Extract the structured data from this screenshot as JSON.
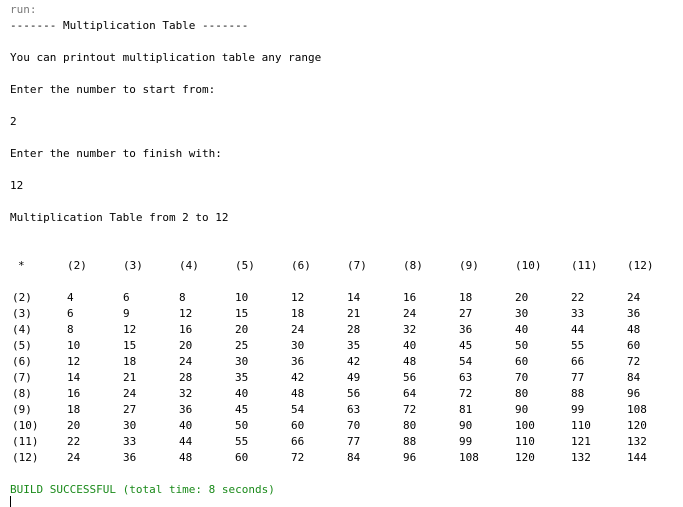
{
  "console": {
    "run_label": "run:",
    "title_line": "------- Multiplication Table -------",
    "intro": "You can printout multiplication table any range",
    "prompt_start": "Enter the number to start from:",
    "start_value": "2",
    "prompt_finish": "Enter the number to finish with:",
    "finish_value": "12",
    "table_caption": "Multiplication Table from 2 to 12",
    "build_status": "BUILD SUCCESSFUL (total time: 8 seconds)"
  },
  "table": {
    "corner": "*",
    "headers": [
      "(2)",
      "(3)",
      "(4)",
      "(5)",
      "(6)",
      "(7)",
      "(8)",
      "(9)",
      "(10)",
      "(11)",
      "(12)"
    ],
    "rows": [
      {
        "label": "(2)",
        "values": [
          "4",
          "6",
          "8",
          "10",
          "12",
          "14",
          "16",
          "18",
          "20",
          "22",
          "24"
        ]
      },
      {
        "label": "(3)",
        "values": [
          "6",
          "9",
          "12",
          "15",
          "18",
          "21",
          "24",
          "27",
          "30",
          "33",
          "36"
        ]
      },
      {
        "label": "(4)",
        "values": [
          "8",
          "12",
          "16",
          "20",
          "24",
          "28",
          "32",
          "36",
          "40",
          "44",
          "48"
        ]
      },
      {
        "label": "(5)",
        "values": [
          "10",
          "15",
          "20",
          "25",
          "30",
          "35",
          "40",
          "45",
          "50",
          "55",
          "60"
        ]
      },
      {
        "label": "(6)",
        "values": [
          "12",
          "18",
          "24",
          "30",
          "36",
          "42",
          "48",
          "54",
          "60",
          "66",
          "72"
        ]
      },
      {
        "label": "(7)",
        "values": [
          "14",
          "21",
          "28",
          "35",
          "42",
          "49",
          "56",
          "63",
          "70",
          "77",
          "84"
        ]
      },
      {
        "label": "(8)",
        "values": [
          "16",
          "24",
          "32",
          "40",
          "48",
          "56",
          "64",
          "72",
          "80",
          "88",
          "96"
        ]
      },
      {
        "label": "(9)",
        "values": [
          "18",
          "27",
          "36",
          "45",
          "54",
          "63",
          "72",
          "81",
          "90",
          "99",
          "108"
        ]
      },
      {
        "label": "(10)",
        "values": [
          "20",
          "30",
          "40",
          "50",
          "60",
          "70",
          "80",
          "90",
          "100",
          "110",
          "120"
        ]
      },
      {
        "label": "(11)",
        "values": [
          "22",
          "33",
          "44",
          "55",
          "66",
          "77",
          "88",
          "99",
          "110",
          "121",
          "132"
        ]
      },
      {
        "label": "(12)",
        "values": [
          "24",
          "36",
          "48",
          "60",
          "72",
          "84",
          "96",
          "108",
          "120",
          "132",
          "144"
        ]
      }
    ]
  }
}
